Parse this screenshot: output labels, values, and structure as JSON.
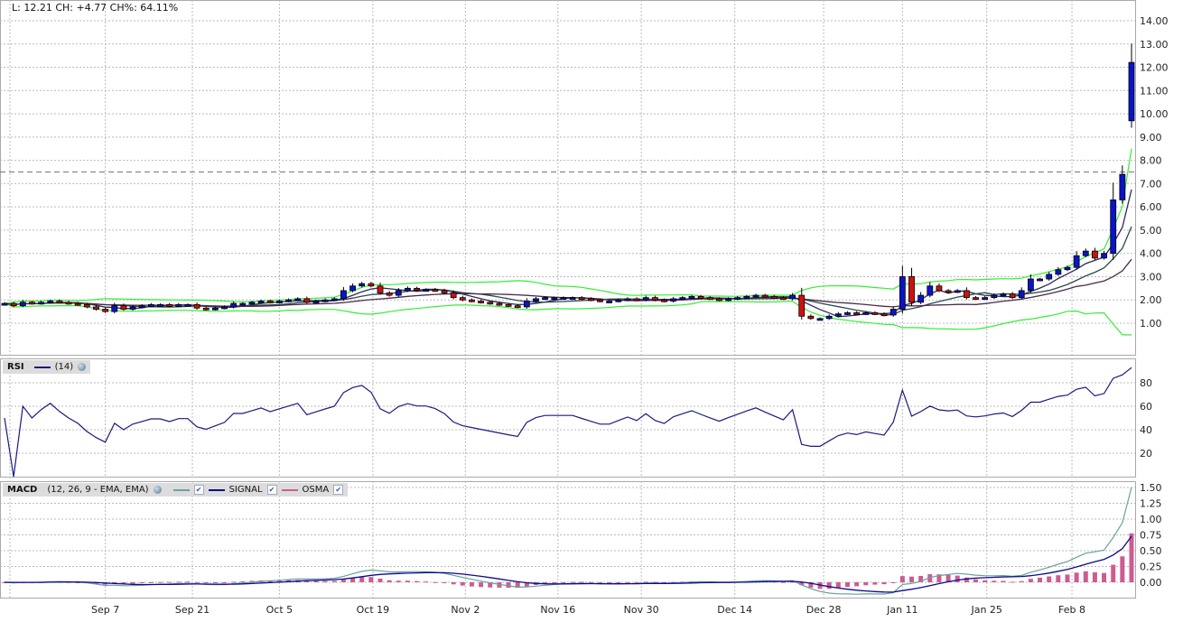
{
  "header": {
    "summary": "L: 12.21 CH: +4.77 CH%: 64.11%"
  },
  "colors": {
    "up": "#0a14c8",
    "down": "#d01010",
    "band": "#33ee33",
    "ma1": "#2a2a5a",
    "ma2": "#2a4a4a",
    "ma3": "#4a2a4a",
    "rsi": "#1a1a80",
    "macd": "#6aa0a0",
    "signal": "#0a0a90",
    "osma": "#cc5c92"
  },
  "chart_data": [
    {
      "type": "candlestick",
      "title": "Price",
      "closes": [
        1.85,
        1.75,
        1.9,
        1.85,
        1.9,
        1.95,
        1.9,
        1.85,
        1.8,
        1.7,
        1.6,
        1.5,
        1.75,
        1.6,
        1.7,
        1.75,
        1.8,
        1.8,
        1.75,
        1.8,
        1.8,
        1.65,
        1.6,
        1.65,
        1.7,
        1.85,
        1.85,
        1.9,
        1.95,
        1.9,
        1.95,
        2.0,
        2.05,
        1.9,
        1.95,
        2.0,
        2.05,
        2.4,
        2.6,
        2.7,
        2.6,
        2.3,
        2.2,
        2.4,
        2.5,
        2.45,
        2.45,
        2.4,
        2.3,
        2.1,
        2.0,
        1.95,
        1.9,
        1.85,
        1.8,
        1.75,
        1.7,
        1.95,
        2.05,
        2.1,
        2.1,
        2.1,
        2.1,
        2.05,
        2.0,
        1.95,
        1.95,
        2.0,
        2.05,
        2.0,
        2.1,
        2.0,
        1.95,
        2.05,
        2.1,
        2.15,
        2.1,
        2.05,
        2.0,
        2.05,
        2.1,
        2.15,
        2.2,
        2.15,
        2.1,
        2.05,
        2.2,
        1.3,
        1.2,
        1.2,
        1.3,
        1.4,
        1.45,
        1.4,
        1.45,
        1.4,
        1.35,
        1.6,
        3.0,
        1.9,
        2.2,
        2.6,
        2.4,
        2.35,
        2.4,
        2.1,
        2.05,
        2.1,
        2.2,
        2.25,
        2.1,
        2.4,
        2.9,
        2.9,
        3.1,
        3.3,
        3.4,
        3.9,
        4.1,
        3.8,
        4.0,
        6.3,
        7.4,
        12.21
      ],
      "last_open": 9.7,
      "reference_line": 7.5,
      "ylim": [
        0,
        14.5
      ],
      "yticks": [
        "1.00",
        "2.00",
        "3.00",
        "4.00",
        "5.00",
        "6.00",
        "7.00",
        "8.00",
        "9.00",
        "10.00",
        "11.00",
        "12.00",
        "13.00",
        "14.00"
      ],
      "overlays": [
        "Bollinger Bands (20, 2)",
        "SMA 5",
        "SMA 10",
        "SMA 20"
      ]
    },
    {
      "type": "line",
      "title": "RSI",
      "period": "(14)",
      "ylim": [
        0,
        100
      ],
      "yticks": [
        "20",
        "40",
        "60",
        "80"
      ]
    },
    {
      "type": "line+bar",
      "title": "MACD",
      "params": "(12, 26, 9 - EMA, EMA)",
      "legend": [
        "",
        "SIGNAL",
        "OSMA"
      ],
      "ylim": [
        -0.2,
        1.6
      ],
      "yticks": [
        "0.00",
        "0.25",
        "0.50",
        "0.75",
        "1.00",
        "1.25",
        "1.50"
      ]
    }
  ],
  "xaxis": {
    "labels": [
      {
        "text": "Sep 7",
        "index": 11
      },
      {
        "text": "Sep 21",
        "index": 20.5
      },
      {
        "text": "Oct 5",
        "index": 30
      },
      {
        "text": "Oct 19",
        "index": 40.2
      },
      {
        "text": "Nov 2",
        "index": 50.3
      },
      {
        "text": "Nov 16",
        "index": 60.4
      },
      {
        "text": "Nov 30",
        "index": 69.5
      },
      {
        "text": "Dec 14",
        "index": 79.7
      },
      {
        "text": "Dec 28",
        "index": 89.4
      },
      {
        "text": "Jan 11",
        "index": 98
      },
      {
        "text": "Jan 25",
        "index": 107.2
      },
      {
        "text": "Feb 8",
        "index": 116.5
      }
    ]
  }
}
